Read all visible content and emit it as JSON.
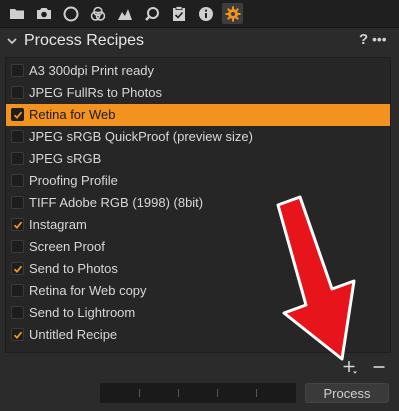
{
  "toolbar": {
    "tools": [
      {
        "icon": "folder-icon"
      },
      {
        "icon": "camera-icon"
      },
      {
        "icon": "lens-icon"
      },
      {
        "icon": "color-circles-icon"
      },
      {
        "icon": "exposure-icon"
      },
      {
        "icon": "magnifier-icon"
      },
      {
        "icon": "clipboard-icon"
      },
      {
        "icon": "info-icon"
      },
      {
        "icon": "gear-icon",
        "active": true
      }
    ],
    "active_color": "#f2921f"
  },
  "panel": {
    "title": "Process Recipes",
    "help": "?",
    "more": "•••"
  },
  "recipes": [
    {
      "label": "A3 300dpi Print ready",
      "checked": false,
      "selected": false
    },
    {
      "label": "JPEG FullRs to Photos",
      "checked": false,
      "selected": false
    },
    {
      "label": "Retina for Web",
      "checked": true,
      "selected": true
    },
    {
      "label": "JPEG sRGB QuickProof (preview size)",
      "checked": false,
      "selected": false
    },
    {
      "label": "JPEG sRGB",
      "checked": false,
      "selected": false
    },
    {
      "label": "Proofing Profile",
      "checked": false,
      "selected": false
    },
    {
      "label": "TIFF Adobe RGB (1998) (8bit)",
      "checked": false,
      "selected": false
    },
    {
      "label": "Instagram",
      "checked": true,
      "selected": false
    },
    {
      "label": "Screen Proof",
      "checked": false,
      "selected": false
    },
    {
      "label": "Send to Photos",
      "checked": true,
      "selected": false
    },
    {
      "label": "Retina for Web copy",
      "checked": false,
      "selected": false
    },
    {
      "label": "Send to Lightroom",
      "checked": false,
      "selected": false
    },
    {
      "label": "Untitled Recipe",
      "checked": true,
      "selected": false
    }
  ],
  "footer": {
    "add": "+",
    "remove": "−",
    "process_label": "Process"
  },
  "annotation": {
    "arrow_color": "#e8141c"
  }
}
